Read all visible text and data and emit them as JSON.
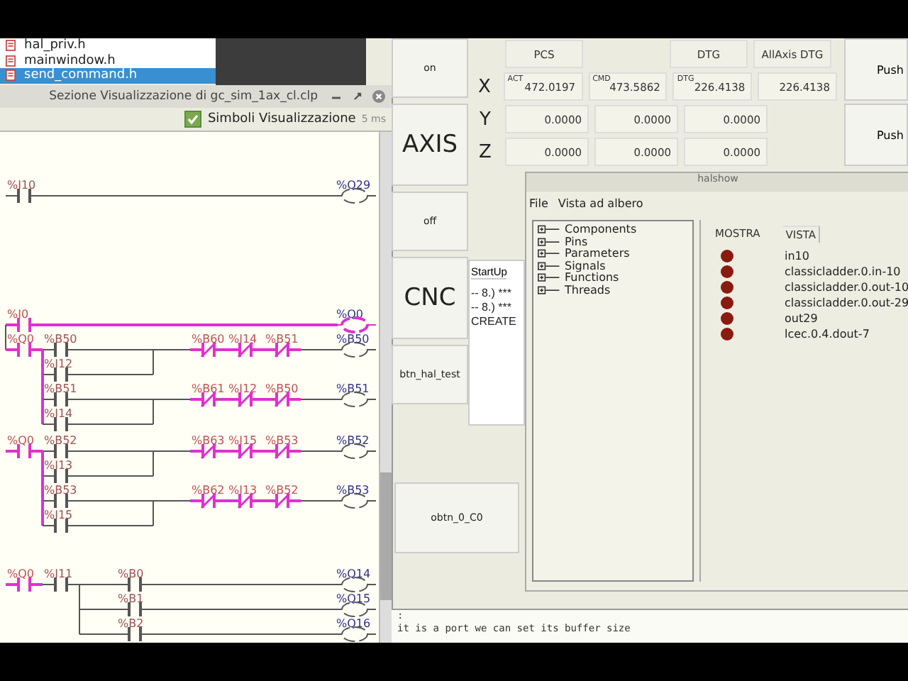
{
  "file_list": {
    "items": [
      {
        "name": "hal_priv.h",
        "selected": false
      },
      {
        "name": "mainwindow.h",
        "selected": false
      },
      {
        "name": "send_command.h",
        "selected": true
      }
    ]
  },
  "ladder_window": {
    "title": "Sezione Visualizzazione di gc_sim_1ax_cl.clp",
    "symbols_checkbox": {
      "label": "Simboli Visualizzazione",
      "checked": true
    },
    "scan_time": "5 ms",
    "rungs": [
      {
        "rows": [
          {
            "cells": [
              {
                "kind": "no",
                "label": "%I10",
                "active": false
              },
              {
                "kind": "wire",
                "active": false
              },
              {
                "kind": "wire",
                "active": false
              },
              {
                "kind": "wire",
                "active": false
              },
              {
                "kind": "wire",
                "active": false
              },
              {
                "kind": "wire",
                "active": false
              },
              {
                "kind": "wire",
                "active": false
              },
              {
                "kind": "wire",
                "active": false
              },
              {
                "kind": "wire",
                "active": false
              }
            ],
            "coil": {
              "label": "%Q29",
              "active": false
            }
          }
        ]
      },
      {
        "rows": [
          {
            "cells": [
              {
                "kind": "no",
                "label": "%I0",
                "active": true
              },
              {
                "kind": "wire",
                "active": true
              },
              {
                "kind": "wire",
                "active": true
              },
              {
                "kind": "wire",
                "active": true
              },
              {
                "kind": "wire",
                "active": true
              },
              {
                "kind": "wire",
                "active": true
              },
              {
                "kind": "wire",
                "active": true
              },
              {
                "kind": "wire",
                "active": true
              },
              {
                "kind": "wire",
                "active": true
              }
            ],
            "coil": {
              "label": "%Q0",
              "active": true
            }
          },
          {
            "link_active": false,
            "cells": [
              {
                "kind": "no",
                "label": "%Q0",
                "active": true
              },
              {
                "kind": "no",
                "label": "%B50",
                "active": false
              },
              {
                "kind": "wire",
                "active": false
              },
              {
                "kind": "wire",
                "active": false
              },
              {
                "kind": "wire",
                "active": false
              },
              {
                "kind": "nc",
                "label": "%B60",
                "active": true
              },
              {
                "kind": "nc",
                "label": "%I14",
                "active": true
              },
              {
                "kind": "nc",
                "label": "%B51",
                "active": true
              },
              {
                "kind": "wire",
                "active": false
              }
            ],
            "coil": {
              "label": "%B50",
              "active": false
            }
          },
          {
            "link_active": true,
            "cells": [
              {
                "kind": "empty"
              },
              {
                "kind": "no",
                "label": "%I12",
                "active": false
              },
              {
                "kind": "wire",
                "active": false
              },
              {
                "kind": "wire",
                "active": false
              }
            ]
          },
          {
            "link_active": true,
            "cells": [
              {
                "kind": "empty"
              },
              {
                "kind": "no",
                "label": "%B51",
                "active": false
              },
              {
                "kind": "wire",
                "active": false
              },
              {
                "kind": "wire",
                "active": false
              },
              {
                "kind": "wire",
                "active": false
              },
              {
                "kind": "nc",
                "label": "%B61",
                "active": true
              },
              {
                "kind": "nc",
                "label": "%I12",
                "active": true
              },
              {
                "kind": "nc",
                "label": "%B50",
                "active": true
              },
              {
                "kind": "wire",
                "active": false
              }
            ],
            "coil": {
              "label": "%B51",
              "active": false
            }
          },
          {
            "link_active": true,
            "cells": [
              {
                "kind": "empty"
              },
              {
                "kind": "no",
                "label": "%I14",
                "active": false
              },
              {
                "kind": "wire",
                "active": false
              },
              {
                "kind": "wire",
                "active": false
              }
            ]
          }
        ]
      },
      {
        "rows": [
          {
            "cells": [
              {
                "kind": "no",
                "label": "%Q0",
                "active": true
              },
              {
                "kind": "no",
                "label": "%B52",
                "active": false
              },
              {
                "kind": "wire",
                "active": false
              },
              {
                "kind": "wire",
                "active": false
              },
              {
                "kind": "wire",
                "active": false
              },
              {
                "kind": "nc",
                "label": "%B63",
                "active": true
              },
              {
                "kind": "nc",
                "label": "%I15",
                "active": true
              },
              {
                "kind": "nc",
                "label": "%B53",
                "active": true
              },
              {
                "kind": "wire",
                "active": false
              }
            ],
            "coil": {
              "label": "%B52",
              "active": false
            }
          },
          {
            "link_active": true,
            "cells": [
              {
                "kind": "empty"
              },
              {
                "kind": "no",
                "label": "%I13",
                "active": false
              },
              {
                "kind": "wire",
                "active": false
              },
              {
                "kind": "wire",
                "active": false
              }
            ]
          },
          {
            "link_active": true,
            "cells": [
              {
                "kind": "empty"
              },
              {
                "kind": "no",
                "label": "%B53",
                "active": false
              },
              {
                "kind": "wire",
                "active": false
              },
              {
                "kind": "wire",
                "active": false
              },
              {
                "kind": "wire",
                "active": false
              },
              {
                "kind": "nc",
                "label": "%B62",
                "active": true
              },
              {
                "kind": "nc",
                "label": "%I13",
                "active": true
              },
              {
                "kind": "nc",
                "label": "%B52",
                "active": true
              },
              {
                "kind": "wire",
                "active": false
              }
            ],
            "coil": {
              "label": "%B53",
              "active": false
            }
          },
          {
            "link_active": true,
            "cells": [
              {
                "kind": "empty"
              },
              {
                "kind": "no",
                "label": "%I15",
                "active": false
              },
              {
                "kind": "wire",
                "active": false
              },
              {
                "kind": "wire",
                "active": false
              }
            ]
          }
        ]
      },
      {
        "rows": [
          {
            "cells": [
              {
                "kind": "no",
                "label": "%Q0",
                "active": true
              },
              {
                "kind": "no",
                "label": "%I11",
                "active": false
              },
              {
                "kind": "wire",
                "active": false
              },
              {
                "kind": "no",
                "label": "%B0",
                "active": false
              },
              {
                "kind": "wire",
                "active": false
              },
              {
                "kind": "wire",
                "active": false
              },
              {
                "kind": "wire",
                "active": false
              },
              {
                "kind": "wire",
                "active": false
              },
              {
                "kind": "wire",
                "active": false
              }
            ],
            "coil": {
              "label": "%Q14",
              "active": false
            }
          },
          {
            "link_active": false,
            "cells": [
              {
                "kind": "empty"
              },
              {
                "kind": "empty"
              },
              {
                "kind": "wire",
                "active": false
              },
              {
                "kind": "no",
                "label": "%B1",
                "active": false
              },
              {
                "kind": "wire",
                "active": false
              },
              {
                "kind": "wire",
                "active": false
              },
              {
                "kind": "wire",
                "active": false
              },
              {
                "kind": "wire",
                "active": false
              },
              {
                "kind": "wire",
                "active": false
              }
            ],
            "coil": {
              "label": "%Q15",
              "active": false
            }
          },
          {
            "link_active": false,
            "cells": [
              {
                "kind": "empty"
              },
              {
                "kind": "empty"
              },
              {
                "kind": "wire",
                "active": false
              },
              {
                "kind": "no",
                "label": "%B2",
                "active": false
              },
              {
                "kind": "wire",
                "active": false
              },
              {
                "kind": "wire",
                "active": false
              },
              {
                "kind": "wire",
                "active": false
              },
              {
                "kind": "wire",
                "active": false
              },
              {
                "kind": "wire",
                "active": false
              }
            ],
            "coil": {
              "label": "%Q16",
              "active": false
            }
          }
        ]
      }
    ]
  },
  "side_buttons": [
    {
      "label": "on",
      "kind": "small"
    },
    {
      "label": "AXIS",
      "kind": "large"
    },
    {
      "label": "off",
      "kind": "small"
    },
    {
      "label": "CNC",
      "kind": "large"
    },
    {
      "label": "btn_hal_test",
      "kind": "small"
    }
  ],
  "startup_panel": {
    "tab": "StartUp",
    "lines": [
      "-- 8.) ***",
      "-- 8.) ***",
      "CREATE"
    ]
  },
  "extra_button": {
    "label": "obtn_0_C0"
  },
  "dro": {
    "headers": [
      "PCS",
      "DTG",
      "AllAxis DTG"
    ],
    "rows": [
      {
        "axis": "X",
        "cells": [
          {
            "caption": "ACT",
            "value": "472.0197"
          },
          {
            "caption": "CMD",
            "value": "473.5862"
          },
          {
            "caption": "DTG",
            "value": "226.4138"
          },
          {
            "value": "226.4138"
          }
        ]
      },
      {
        "axis": "Y",
        "cells": [
          {
            "value": "0.0000"
          },
          {
            "value": "0.0000"
          },
          {
            "value": "0.0000"
          }
        ]
      },
      {
        "axis": "Z",
        "cells": [
          {
            "value": "0.0000"
          },
          {
            "value": "0.0000"
          },
          {
            "value": "0.0000"
          }
        ]
      }
    ]
  },
  "push_buttons": [
    "Push",
    "Push"
  ],
  "halshow": {
    "title": "halshow",
    "menu": [
      "File",
      "Vista ad albero"
    ],
    "tree": [
      "Components",
      "Pins",
      "Parameters",
      "Signals",
      "Functions",
      "Threads"
    ],
    "tabs": [
      {
        "label": "MOSTRA",
        "selected": false
      },
      {
        "label": "VISTA",
        "selected": true
      }
    ],
    "signals": [
      {
        "name": "in10",
        "color": "#8b1a10"
      },
      {
        "name": "classicladder.0.in-10",
        "color": "#8b1a10"
      },
      {
        "name": "classicladder.0.out-10",
        "color": "#8b1a10"
      },
      {
        "name": "classicladder.0.out-29",
        "color": "#8b1a10"
      },
      {
        "name": "out29",
        "color": "#8b1a10"
      },
      {
        "name": "lcec.0.4.dout-7",
        "color": "#8b1a10"
      }
    ]
  },
  "console": {
    "lines": [
      ":",
      "it is a port we can set its buffer size"
    ]
  }
}
